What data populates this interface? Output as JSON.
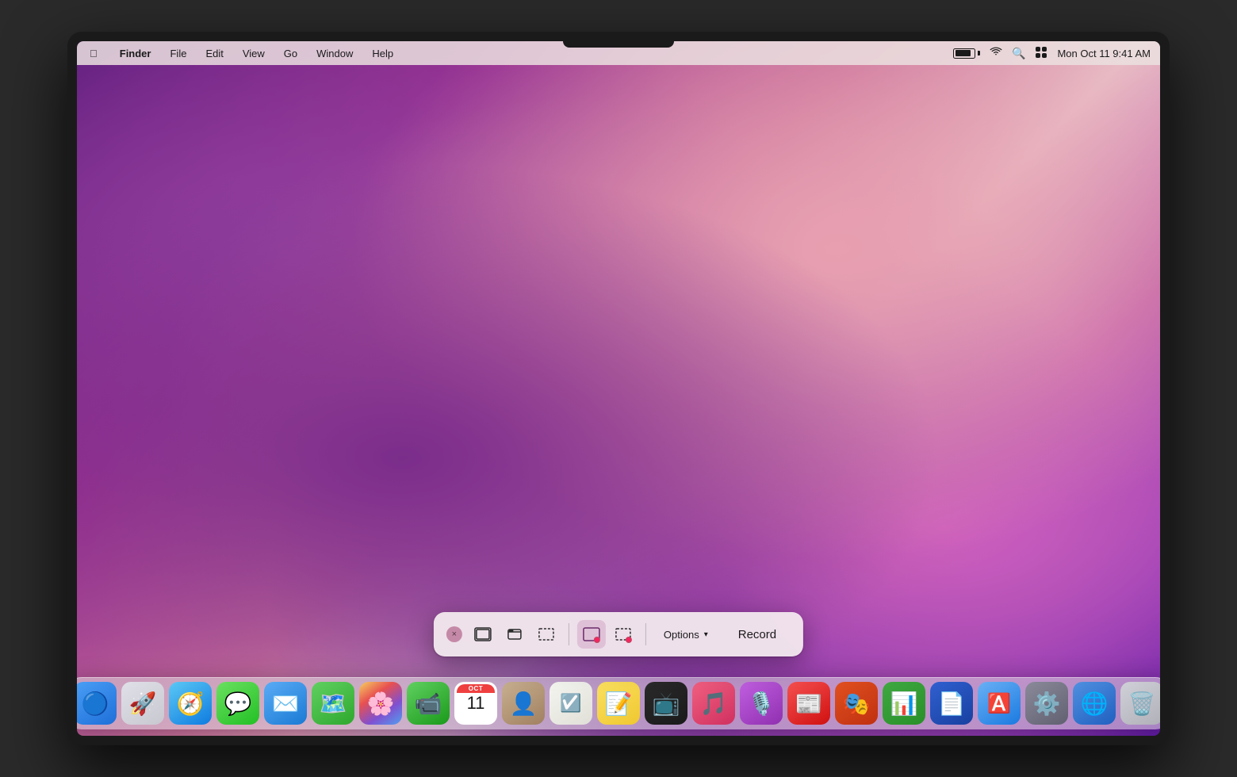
{
  "menubar": {
    "apple_label": "",
    "app_name": "Finder",
    "menus": [
      "File",
      "Edit",
      "View",
      "Go",
      "Window",
      "Help"
    ],
    "datetime": "Mon Oct 11  9:41 AM"
  },
  "toolbar": {
    "close_label": "×",
    "options_label": "Options",
    "record_label": "Record",
    "chevron": "▾"
  },
  "dock": {
    "items": [
      {
        "name": "Finder",
        "class": "dock-finder",
        "icon": "🔵"
      },
      {
        "name": "Launchpad",
        "class": "dock-launchpad",
        "icon": "🚀"
      },
      {
        "name": "Safari",
        "class": "dock-safari",
        "icon": "🧭"
      },
      {
        "name": "Messages",
        "class": "dock-messages",
        "icon": "💬"
      },
      {
        "name": "Mail",
        "class": "dock-mail",
        "icon": "✉️"
      },
      {
        "name": "Maps",
        "class": "dock-maps",
        "icon": "🗺️"
      },
      {
        "name": "Photos",
        "class": "dock-photos",
        "icon": "🌸"
      },
      {
        "name": "FaceTime",
        "class": "dock-facetime",
        "icon": "📹"
      },
      {
        "name": "Calendar",
        "class": "dock-calendar",
        "month": "OCT",
        "day": "11"
      },
      {
        "name": "Contacts",
        "class": "dock-contacts",
        "icon": "👤"
      },
      {
        "name": "Reminders",
        "class": "dock-reminders",
        "icon": "☑️"
      },
      {
        "name": "Notes",
        "class": "dock-notes",
        "icon": "📝"
      },
      {
        "name": "Apple TV",
        "class": "dock-appletv",
        "icon": "📺"
      },
      {
        "name": "Music",
        "class": "dock-music",
        "icon": "🎵"
      },
      {
        "name": "Podcasts",
        "class": "dock-podcasts",
        "icon": "🎙️"
      },
      {
        "name": "News",
        "class": "dock-news",
        "icon": "📰"
      },
      {
        "name": "Keynote",
        "class": "dock-keynote",
        "icon": "🎭"
      },
      {
        "name": "Numbers",
        "class": "dock-numbers",
        "icon": "📊"
      },
      {
        "name": "Pages",
        "class": "dock-pages",
        "icon": "📄"
      },
      {
        "name": "App Store",
        "class": "dock-appstore",
        "icon": "🅰️"
      },
      {
        "name": "System Preferences",
        "class": "dock-systemprefs",
        "icon": "⚙️"
      },
      {
        "name": "DockUtil",
        "class": "dock-dockutil",
        "icon": "🌐"
      },
      {
        "name": "Trash",
        "class": "dock-trash",
        "icon": "🗑️"
      }
    ]
  }
}
